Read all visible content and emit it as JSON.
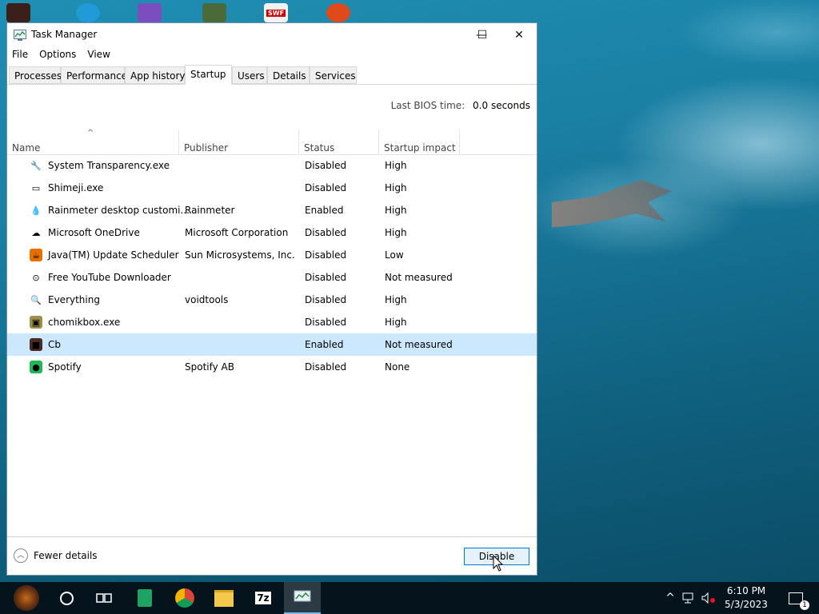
{
  "window": {
    "title": "Task Manager",
    "controls": {
      "minimize": "—",
      "maximize": "☐",
      "close": "✕"
    }
  },
  "menu": [
    "File",
    "Options",
    "View"
  ],
  "tabs": [
    "Processes",
    "Performance",
    "App history",
    "Startup",
    "Users",
    "Details",
    "Services"
  ],
  "active_tab": "Startup",
  "bios": {
    "label": "Last BIOS time:",
    "value": "0.0 seconds"
  },
  "columns": [
    "Name",
    "Publisher",
    "Status",
    "Startup impact"
  ],
  "rows": [
    {
      "name": "System Transparency.exe",
      "publisher": "",
      "status": "Disabled",
      "impact": "High",
      "icon": "wrench-icon",
      "glyph": "🔧",
      "color": "#ffffff"
    },
    {
      "name": "Shimeji.exe",
      "publisher": "",
      "status": "Disabled",
      "impact": "High",
      "icon": "app-window-icon",
      "glyph": "▭",
      "color": "#ffffff"
    },
    {
      "name": "Rainmeter desktop customi...",
      "publisher": "Rainmeter",
      "status": "Enabled",
      "impact": "High",
      "icon": "rainmeter-drop-icon",
      "glyph": "💧",
      "color": "#ffffff"
    },
    {
      "name": "Microsoft OneDrive",
      "publisher": "Microsoft Corporation",
      "status": "Disabled",
      "impact": "High",
      "icon": "onedrive-cloud-icon",
      "glyph": "☁",
      "color": "#ffffff"
    },
    {
      "name": "Java(TM) Update Scheduler",
      "publisher": "Sun Microsystems, Inc.",
      "status": "Disabled",
      "impact": "Low",
      "icon": "java-icon",
      "glyph": "☕",
      "color": "#e76f00"
    },
    {
      "name": "Free YouTube Downloader",
      "publisher": "",
      "status": "Disabled",
      "impact": "Not measured",
      "icon": "youtube-downloader-icon",
      "glyph": "⊙",
      "color": "#ffffff"
    },
    {
      "name": "Everything",
      "publisher": "voidtools",
      "status": "Disabled",
      "impact": "High",
      "icon": "magnifier-icon",
      "glyph": "🔍",
      "color": "#ffffff"
    },
    {
      "name": "chomikbox.exe",
      "publisher": "",
      "status": "Disabled",
      "impact": "High",
      "icon": "chomikbox-icon",
      "glyph": "▣",
      "color": "#9b8f4a"
    },
    {
      "name": "Cb",
      "publisher": "",
      "status": "Enabled",
      "impact": "Not measured",
      "icon": "cb-icon",
      "glyph": "■",
      "color": "#4a2a22"
    },
    {
      "name": "Spotify",
      "publisher": "Spotify AB",
      "status": "Disabled",
      "impact": "None",
      "icon": "spotify-icon",
      "glyph": "●",
      "color": "#1db954"
    }
  ],
  "selected_row": "Cb",
  "footer": {
    "fewer_details": "Fewer details",
    "disable_button": "Disable"
  },
  "taskbar": {
    "items": [
      "start-icon",
      "cortana-circle-icon",
      "task-view-icon",
      "sheets-icon",
      "chrome-icon",
      "file-explorer-icon",
      "7zip-icon",
      "task-manager-icon"
    ],
    "seven_zip_label": "7z",
    "clock_time": "6:10 PM",
    "clock_date": "5/3/2023",
    "notification_count": "1"
  },
  "colors": {
    "accent": "#0078d7",
    "selection": "#cce8ff",
    "taskbar": "#05141c"
  }
}
